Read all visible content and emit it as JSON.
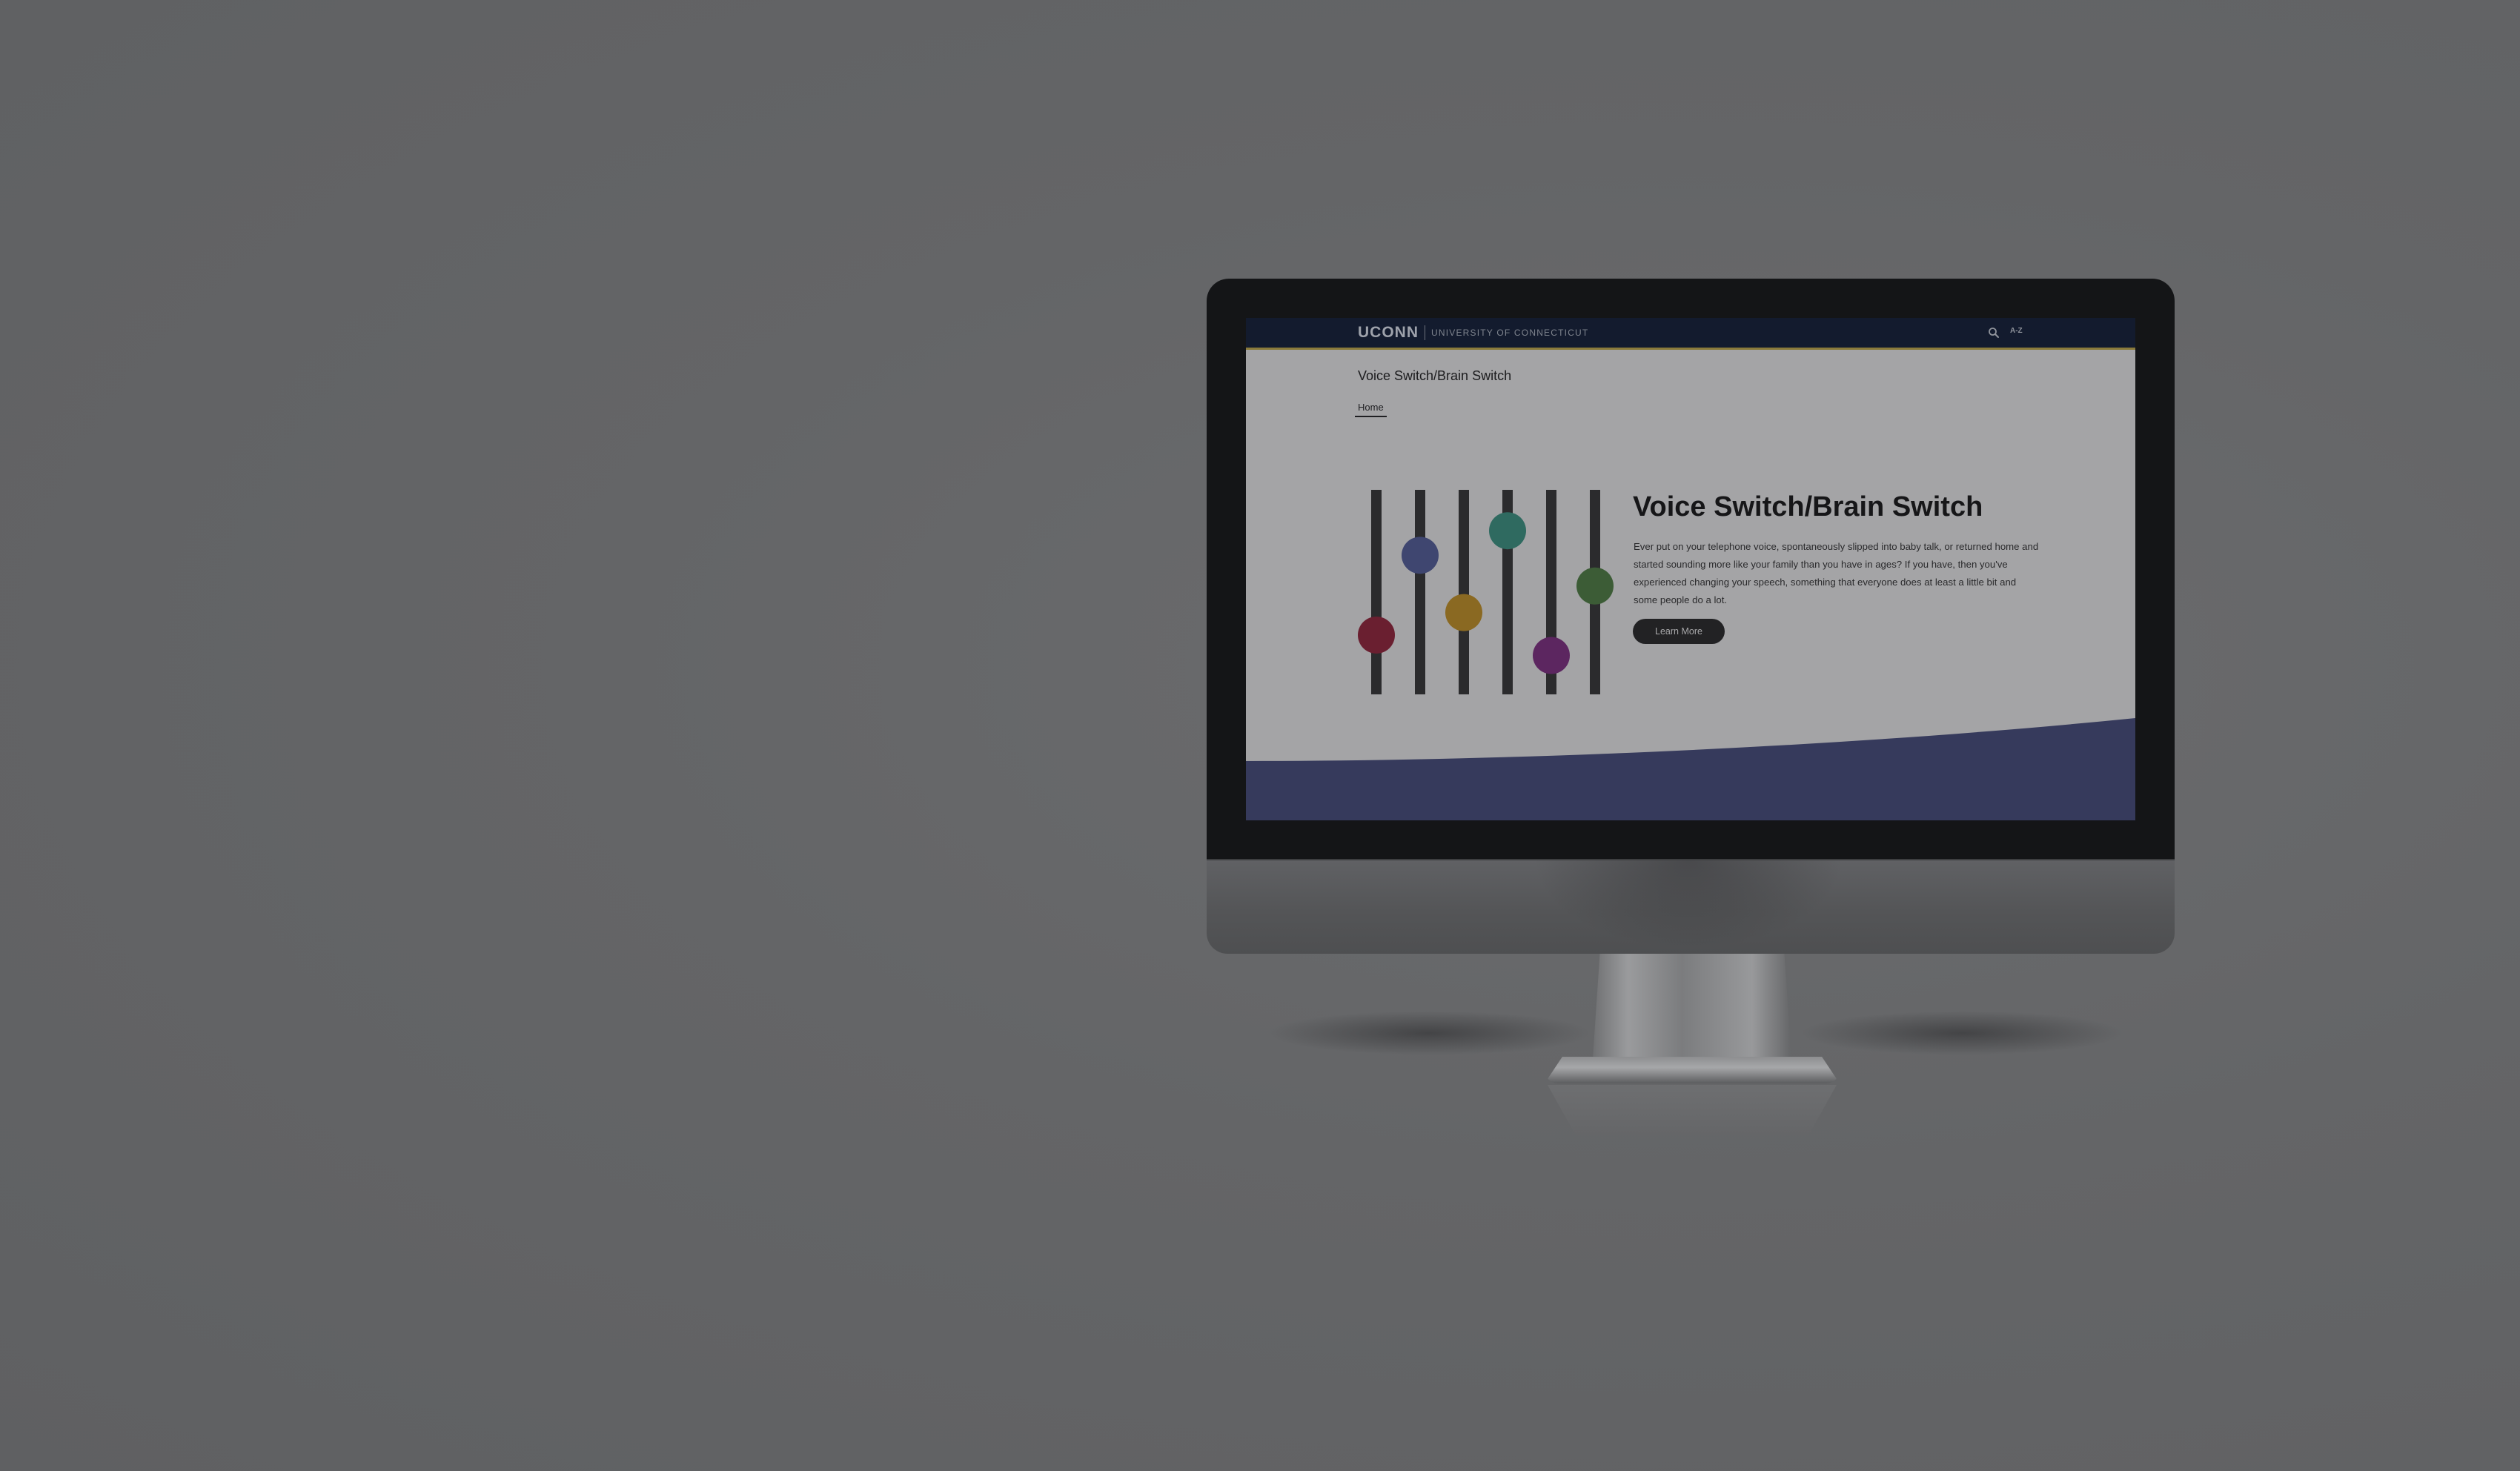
{
  "header": {
    "logo_text": "UCONN",
    "university_name": "UNIVERSITY OF CONNECTICUT",
    "az_link": "A-Z"
  },
  "site": {
    "title": "Voice Switch/Brain Switch",
    "nav": [
      {
        "label": "Home",
        "active": true
      }
    ]
  },
  "hero": {
    "heading": "Voice Switch/Brain Switch",
    "body": "Ever put on your telephone voice, spontaneously slipped into baby talk, or returned home and started sounding more like your family than you have in ages?  If you have, then you've experienced changing your speech, something that everyone does at least a little bit and some people do a lot.",
    "button_label": "Learn More"
  },
  "mixer": {
    "knob_levels": [
      0.29,
      0.68,
      0.4,
      0.8,
      0.19,
      0.53
    ],
    "knob_colors": [
      "#6a1f30",
      "#3f4670",
      "#8a6922",
      "#2f6a60",
      "#5c2660",
      "#3c5c36"
    ]
  },
  "colors": {
    "topbar": "#131b2e",
    "accent_line": "#8a7a3a",
    "wave": "#363a5c",
    "page_bg": "#a4a4a6"
  }
}
